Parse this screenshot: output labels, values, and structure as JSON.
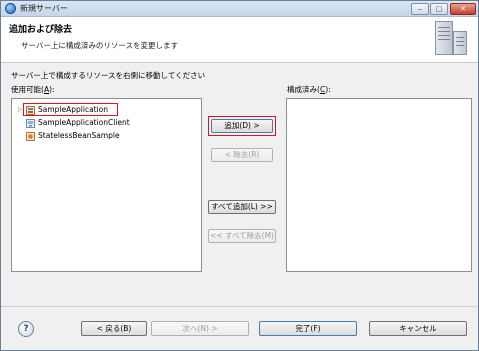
{
  "window": {
    "title": "新規サーバー",
    "minimize_glyph": "‒",
    "maximize_glyph": "□",
    "close_glyph": "✕"
  },
  "header": {
    "title": "追加および除去",
    "description": "サーバー上に構成済みのリソースを変更します"
  },
  "instruction": "サーバー上で構成するリソースを右側に移動してください",
  "available": {
    "label": "使用可能(",
    "accel": "A",
    "label_end": "):",
    "items": [
      {
        "label": "SampleApplication",
        "icon": "ear-project-icon"
      },
      {
        "label": "SampleApplicationClient",
        "icon": "client-project-icon"
      },
      {
        "label": "StatelessBeanSample",
        "icon": "ejb-project-icon"
      }
    ]
  },
  "configured": {
    "label": "構成済み(",
    "accel": "C",
    "label_end": "):",
    "items": []
  },
  "buttons": {
    "add": "追加(D) >",
    "remove": "< 除去(R)",
    "add_all": "すべて追加(L) >>",
    "remove_all": "<< すべて除去(M)"
  },
  "footer": {
    "help": "?",
    "back": "< 戻る(B)",
    "next": "次へ(N) >",
    "finish": "完了(F)",
    "cancel": "キャンセル"
  },
  "colors": {
    "highlight": "#e0151b"
  }
}
